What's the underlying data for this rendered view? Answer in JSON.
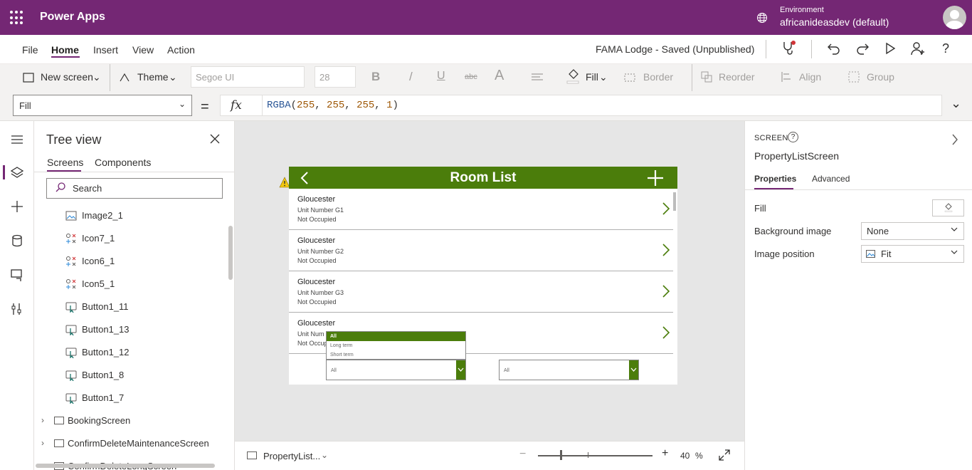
{
  "app": {
    "name": "Power Apps",
    "environment_label": "Environment",
    "environment_value": "africanideasdev (default)",
    "brand_color": "#742774"
  },
  "menu": {
    "items": [
      "File",
      "Home",
      "Insert",
      "View",
      "Action"
    ],
    "active": "Home",
    "document_title": "FAMA Lodge - Saved (Unpublished)"
  },
  "ribbon": {
    "new_screen": "New screen",
    "theme": "Theme",
    "font": "Segoe UI",
    "font_size": "28",
    "bold": "B",
    "italic": "/",
    "underline": "U",
    "strike": "abc",
    "font_glyph": "A",
    "fill": "Fill",
    "border": "Border",
    "reorder": "Reorder",
    "align": "Align",
    "group": "Group"
  },
  "formula": {
    "property": "Fill",
    "equals": "=",
    "fx": "fx",
    "fn": "RGBA",
    "args": [
      "255",
      "255",
      "255",
      "1"
    ]
  },
  "tree": {
    "title": "Tree view",
    "tabs": [
      "Screens",
      "Components"
    ],
    "search_placeholder": "Search",
    "items": [
      {
        "label": "Image2_1",
        "icon": "image-icon"
      },
      {
        "label": "Icon7_1",
        "icon": "icon-control-icon"
      },
      {
        "label": "Icon6_1",
        "icon": "icon-control-icon"
      },
      {
        "label": "Icon5_1",
        "icon": "icon-control-icon"
      },
      {
        "label": "Button1_11",
        "icon": "button-icon"
      },
      {
        "label": "Button1_13",
        "icon": "button-icon"
      },
      {
        "label": "Button1_12",
        "icon": "button-icon"
      },
      {
        "label": "Button1_8",
        "icon": "button-icon"
      },
      {
        "label": "Button1_7",
        "icon": "button-icon"
      }
    ],
    "screens": [
      "BookingScreen",
      "ConfirmDeleteMaintenanceScreen",
      "ConfirmDeleteLongScreen"
    ]
  },
  "canvas": {
    "screen_title": "Room List",
    "header_color": "#4b7d0b",
    "rooms": [
      {
        "name": "Gloucester",
        "unit": "Unit Number G1",
        "status": "Not Occupied"
      },
      {
        "name": "Gloucester",
        "unit": "Unit Number G2",
        "status": "Not Occupied"
      },
      {
        "name": "Gloucester",
        "unit": "Unit Number G3",
        "status": "Not Occupied"
      },
      {
        "name": "Gloucester",
        "unit": "Unit Num",
        "status": "Not Occup"
      }
    ],
    "dropdown_options": [
      "All",
      "Long term",
      "Short term"
    ],
    "dropdown_left_value": "All",
    "dropdown_right_value": "All"
  },
  "footer": {
    "screen_name": "PropertyList...",
    "zoom_value": "40",
    "zoom_unit": "%",
    "zoom_minus": "−",
    "zoom_plus": "+"
  },
  "properties": {
    "section": "SCREEN",
    "name": "PropertyListScreen",
    "tabs": [
      "Properties",
      "Advanced"
    ],
    "fill_label": "Fill",
    "background_image_label": "Background image",
    "background_image_value": "None",
    "image_position_label": "Image position",
    "image_position_value": "Fit"
  }
}
